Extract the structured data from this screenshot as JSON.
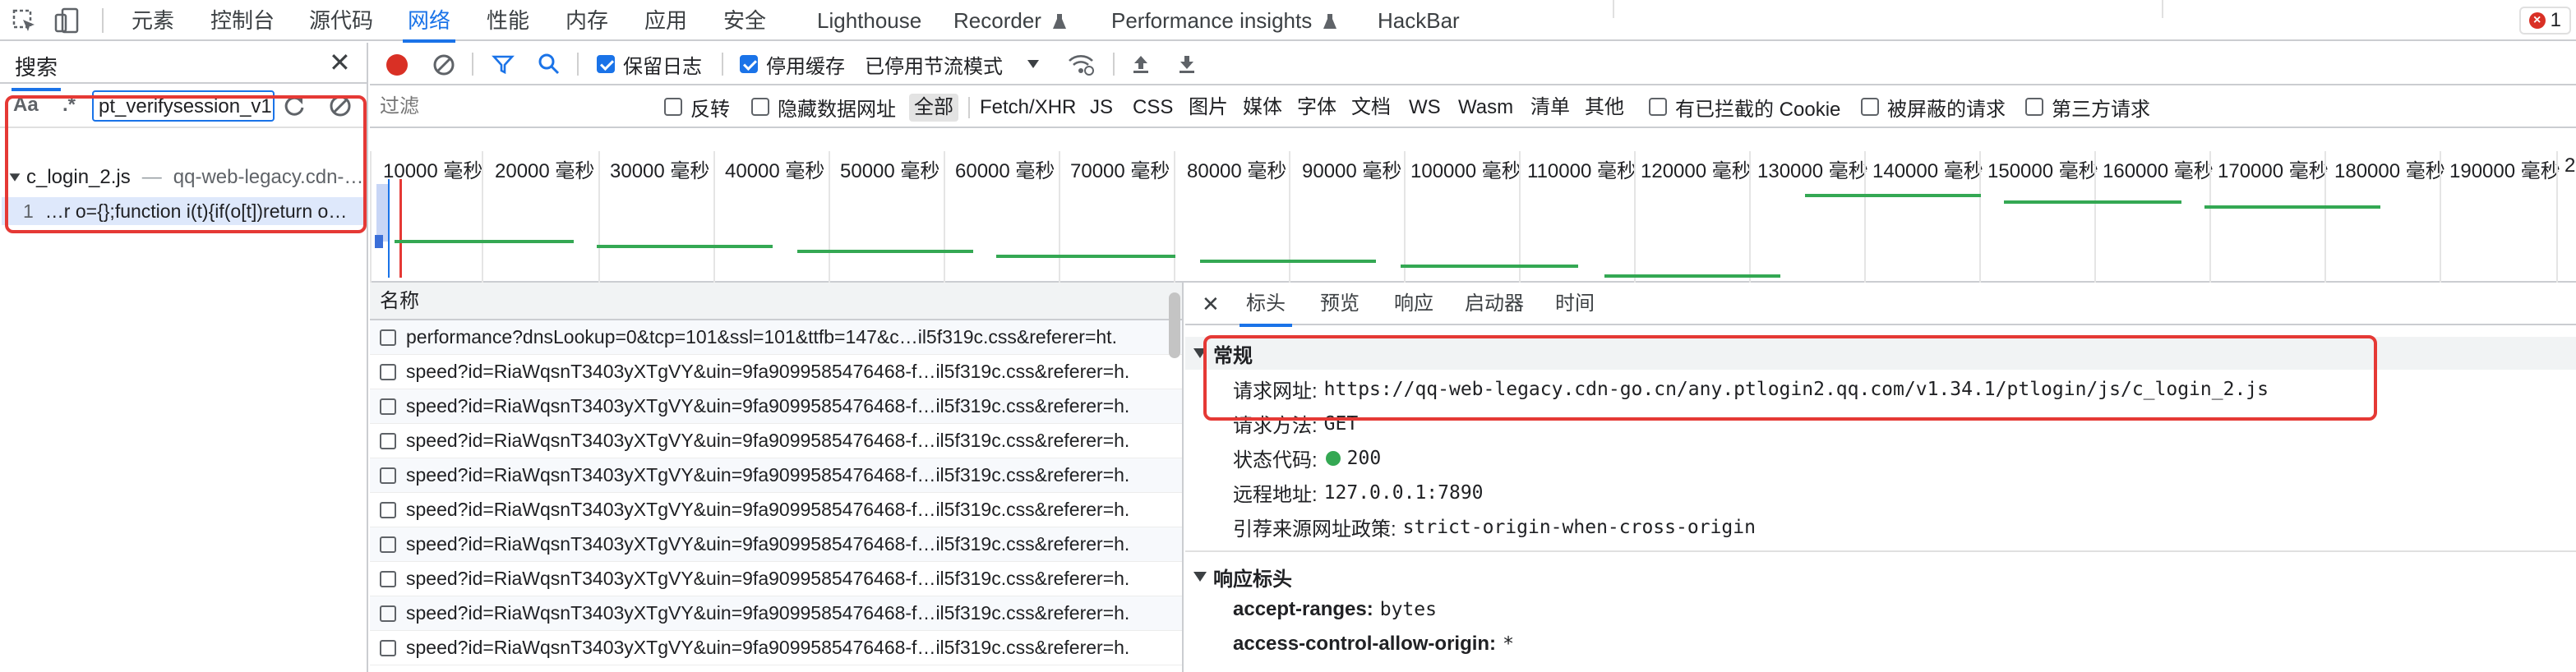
{
  "tabs": [
    "元素",
    "控制台",
    "源代码",
    "网络",
    "性能",
    "内存",
    "应用",
    "安全",
    "Lighthouse",
    "Recorder",
    "Performance insights",
    "HackBar"
  ],
  "error_count": "1",
  "search": {
    "title": "搜索",
    "match_case": "Aa",
    "regex": ".*",
    "query": "pt_verifysession_v1",
    "result_file": "c_login_2.js",
    "result_origin": "qq-web-legacy.cdn-…",
    "result_line": "1",
    "result_snippet": "…r o={};function i(t){if(o[t])return o…"
  },
  "toolbar": {
    "preserve_log": "保留日志",
    "disable_cache": "停用缓存",
    "throttle": "已停用节流模式"
  },
  "filter": {
    "placeholder": "过滤",
    "invert": "反转",
    "hide_data_urls": "隐藏数据网址",
    "types": [
      "全部",
      "Fetch/XHR",
      "JS",
      "CSS",
      "图片",
      "媒体",
      "字体",
      "文档",
      "WS",
      "Wasm",
      "清单",
      "其他"
    ],
    "blocked_cookies": "有已拦截的 Cookie",
    "blocked_requests": "被屏蔽的请求",
    "third_party": "第三方请求"
  },
  "timeline": {
    "ticks": [
      "10000 毫秒",
      "20000 毫秒",
      "30000 毫秒",
      "40000 毫秒",
      "50000 毫秒",
      "60000 毫秒",
      "70000 毫秒",
      "80000 毫秒",
      "90000 毫秒",
      "100000 毫秒",
      "110000 毫秒",
      "120000 毫秒",
      "130000 毫秒",
      "140000 毫秒",
      "150000 毫秒",
      "160000 毫秒",
      "170000 毫秒",
      "180000 毫秒",
      "190000 毫秒"
    ],
    "tail": "2"
  },
  "requests": {
    "header": "名称",
    "rows": [
      "performance?dnsLookup=0&tcp=101&ssl=101&ttfb=147&c…il5f319c.css&referer=ht.",
      "speed?id=RiaWqsnT3403yXTgVY&uin=9fa9099585476468-f…il5f319c.css&referer=h.",
      "speed?id=RiaWqsnT3403yXTgVY&uin=9fa9099585476468-f…il5f319c.css&referer=h.",
      "speed?id=RiaWqsnT3403yXTgVY&uin=9fa9099585476468-f…il5f319c.css&referer=h.",
      "speed?id=RiaWqsnT3403yXTgVY&uin=9fa9099585476468-f…il5f319c.css&referer=h.",
      "speed?id=RiaWqsnT3403yXTgVY&uin=9fa9099585476468-f…il5f319c.css&referer=h.",
      "speed?id=RiaWqsnT3403yXTgVY&uin=9fa9099585476468-f…il5f319c.css&referer=h.",
      "speed?id=RiaWqsnT3403yXTgVY&uin=9fa9099585476468-f…il5f319c.css&referer=h.",
      "speed?id=RiaWqsnT3403yXTgVY&uin=9fa9099585476468-f…il5f319c.css&referer=h.",
      "speed?id=RiaWqsnT3403yXTgVY&uin=9fa9099585476468-f…il5f319c.css&referer=h."
    ]
  },
  "details": {
    "tabs": [
      "标头",
      "预览",
      "响应",
      "启动器",
      "时间"
    ],
    "general_title": "常规",
    "request_url_label": "请求网址:",
    "request_url": "https://qq-web-legacy.cdn-go.cn/any.ptlogin2.qq.com/v1.34.1/ptlogin/js/c_login_2.js",
    "method_label": "请求方法:",
    "method": "GET",
    "status_label": "状态代码:",
    "status": "200",
    "remote_label": "远程地址:",
    "remote": "127.0.0.1:7890",
    "referrer_label": "引荐来源网址政策:",
    "referrer": "strict-origin-when-cross-origin",
    "response_headers_title": "响应标头",
    "headers": [
      {
        "k": "accept-ranges:",
        "v": "bytes"
      },
      {
        "k": "access-control-allow-origin:",
        "v": "*"
      }
    ]
  },
  "colors": {
    "accent": "#1a73e8",
    "record": "#d93025",
    "highlight_box": "#e53935",
    "timing": "#34a853"
  }
}
